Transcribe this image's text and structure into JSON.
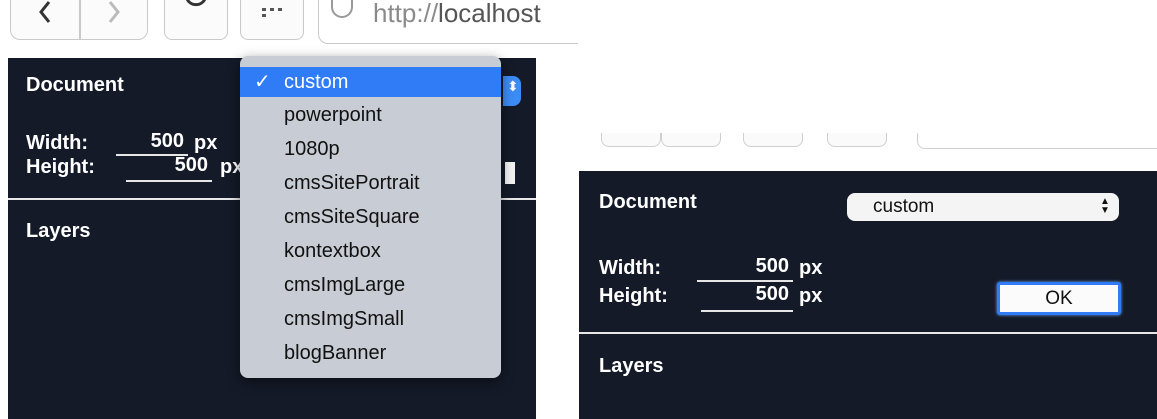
{
  "left": {
    "browser": {
      "address": "http://localhost",
      "address_scheme": "http://",
      "address_host": "localhost"
    },
    "panel": {
      "document_label": "Document",
      "width_label": "Width:",
      "width_value": "500",
      "height_label": "Height:",
      "height_value": "500",
      "unit": "px",
      "layers_label": "Layers"
    },
    "dropdown": {
      "selected": "custom",
      "options": [
        "custom",
        "powerpoint",
        "1080p",
        "cmsSitePortrait",
        "cmsSiteSquare",
        "kontextbox",
        "cmsImgLarge",
        "cmsImgSmall",
        "blogBanner"
      ]
    }
  },
  "right": {
    "panel": {
      "document_label": "Document",
      "select_value": "custom",
      "width_label": "Width:",
      "width_value": "500",
      "height_label": "Height:",
      "height_value": "500",
      "unit": "px",
      "ok_label": "OK",
      "layers_label": "Layers"
    }
  },
  "colors": {
    "panel_bg": "#141a28",
    "selection_blue": "#2f7cf6",
    "dropdown_bg": "#c8ccd4"
  },
  "icons": {
    "back": "chevron-left-icon",
    "forward": "chevron-right-icon",
    "reload": "reload-icon",
    "apps": "apps-grid-icon",
    "site": "globe-icon",
    "check": "checkmark-icon",
    "select_arrows": "up-down-arrows-icon"
  }
}
